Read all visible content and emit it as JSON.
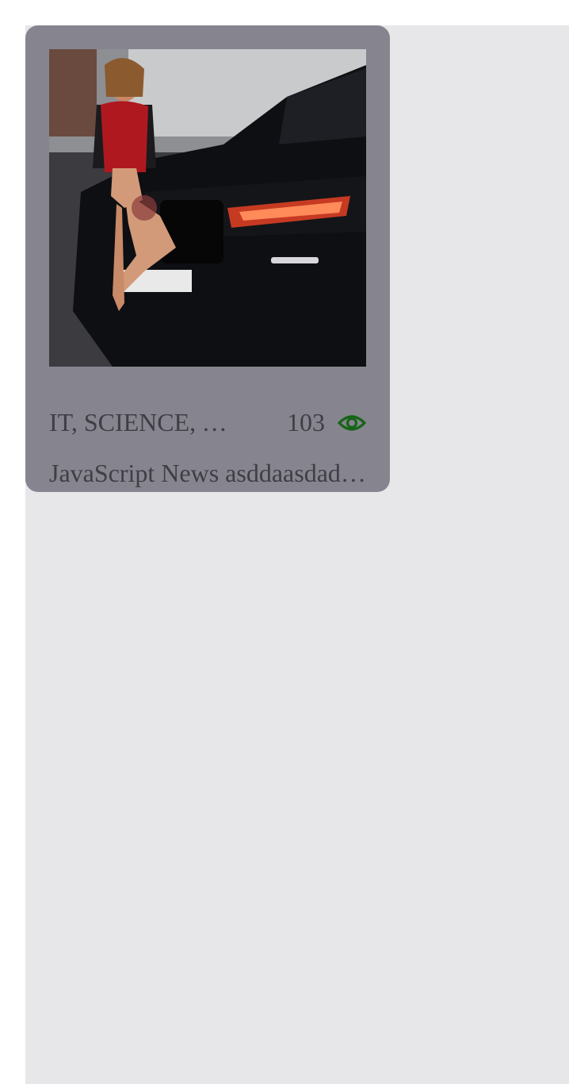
{
  "card": {
    "image_alt": "Woman in red lingerie posing on the front of a black BMW SUV",
    "categories": "IT, SCIENCE, TECH",
    "views": "103",
    "views_icon": "eye-icon",
    "title": "JavaScript News asddaasdadasdasd",
    "colors": {
      "card_bg": "#86858f",
      "text": "#3e3e44",
      "eye_icon": "#176417"
    }
  }
}
